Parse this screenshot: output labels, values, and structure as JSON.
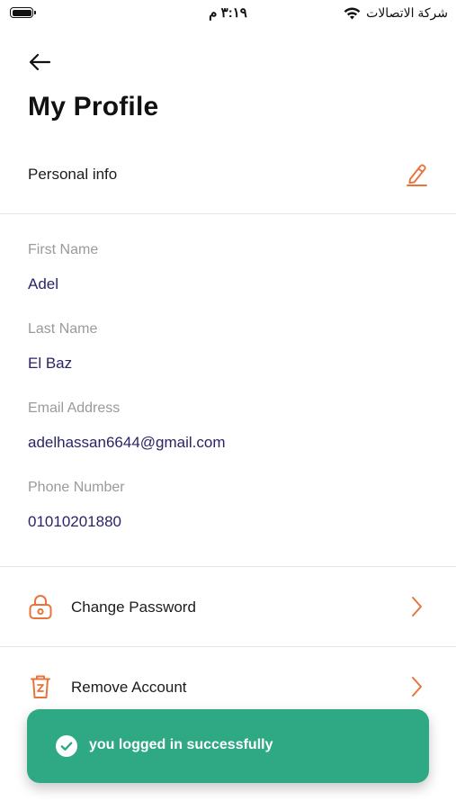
{
  "status_bar": {
    "time": "٣:١٩ م",
    "carrier": "شركة الاتصالات"
  },
  "header": {
    "title": "My Profile"
  },
  "personal_info": {
    "section_label": "Personal info",
    "fields": [
      {
        "label": "First Name",
        "value": "Adel"
      },
      {
        "label": "Last Name",
        "value": "El Baz"
      },
      {
        "label": "Email Address",
        "value": "adelhassan6644@gmail.com"
      },
      {
        "label": "Phone Number",
        "value": "01010201880"
      }
    ]
  },
  "menu": [
    {
      "label": "Change Password",
      "icon": "lock-icon"
    },
    {
      "label": "Remove Account",
      "icon": "trash-icon"
    }
  ],
  "toast": {
    "message": "you logged in successfully",
    "icon": "check-circle-icon"
  },
  "colors": {
    "accent": "#e8743b",
    "value_text": "#2a2466",
    "label_text": "#9a9a9a",
    "toast_bg": "#2ea983"
  }
}
